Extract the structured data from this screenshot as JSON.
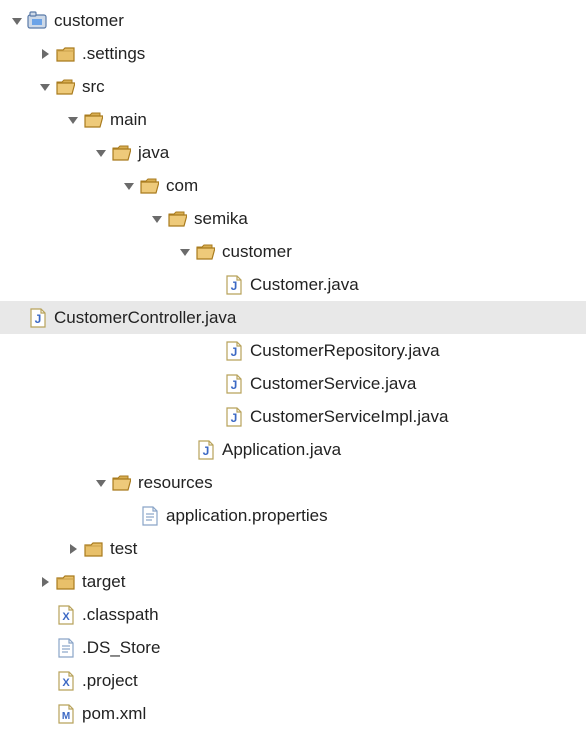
{
  "tree": [
    {
      "level": 0,
      "expand": "down",
      "icon": "project",
      "label": "customer",
      "selected": false
    },
    {
      "level": 1,
      "expand": "right",
      "icon": "folder",
      "label": ".settings",
      "selected": false
    },
    {
      "level": 1,
      "expand": "down",
      "icon": "folder-open",
      "label": "src",
      "selected": false
    },
    {
      "level": 2,
      "expand": "down",
      "icon": "folder-open",
      "label": "main",
      "selected": false
    },
    {
      "level": 3,
      "expand": "down",
      "icon": "folder-open",
      "label": "java",
      "selected": false
    },
    {
      "level": 4,
      "expand": "down",
      "icon": "folder-open",
      "label": "com",
      "selected": false
    },
    {
      "level": 5,
      "expand": "down",
      "icon": "folder-open",
      "label": "semika",
      "selected": false
    },
    {
      "level": 6,
      "expand": "down",
      "icon": "folder-open",
      "label": "customer",
      "selected": false
    },
    {
      "level": 7,
      "expand": "none",
      "icon": "java",
      "label": "Customer.java",
      "selected": false
    },
    {
      "level": 7,
      "expand": "none",
      "icon": "java",
      "label": "CustomerController.java",
      "selected": true
    },
    {
      "level": 7,
      "expand": "none",
      "icon": "java",
      "label": "CustomerRepository.java",
      "selected": false
    },
    {
      "level": 7,
      "expand": "none",
      "icon": "java",
      "label": "CustomerService.java",
      "selected": false
    },
    {
      "level": 7,
      "expand": "none",
      "icon": "java",
      "label": "CustomerServiceImpl.java",
      "selected": false
    },
    {
      "level": 6,
      "expand": "none",
      "icon": "java",
      "label": "Application.java",
      "selected": false
    },
    {
      "level": 3,
      "expand": "down",
      "icon": "folder-open",
      "label": "resources",
      "selected": false
    },
    {
      "level": 4,
      "expand": "none",
      "icon": "text-file",
      "label": "application.properties",
      "selected": false
    },
    {
      "level": 2,
      "expand": "right",
      "icon": "folder",
      "label": "test",
      "selected": false
    },
    {
      "level": 1,
      "expand": "right",
      "icon": "folder",
      "label": "target",
      "selected": false
    },
    {
      "level": 1,
      "expand": "none",
      "icon": "xml-x",
      "label": ".classpath",
      "selected": false
    },
    {
      "level": 1,
      "expand": "none",
      "icon": "text-file",
      "label": ".DS_Store",
      "selected": false
    },
    {
      "level": 1,
      "expand": "none",
      "icon": "xml-x",
      "label": ".project",
      "selected": false
    },
    {
      "level": 1,
      "expand": "none",
      "icon": "xml-m",
      "label": "pom.xml",
      "selected": false
    }
  ]
}
